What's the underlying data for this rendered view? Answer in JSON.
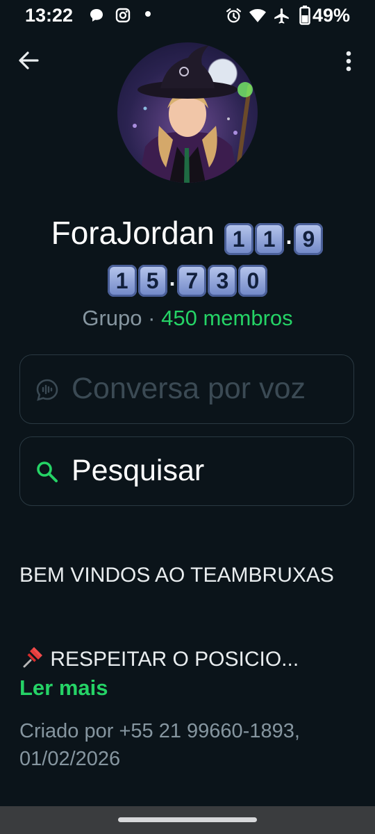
{
  "status_bar": {
    "time": "13:22",
    "battery": "49%",
    "icons": [
      "chat-bubble-icon",
      "instagram-icon",
      "dot-icon",
      "alarm-icon",
      "wifi-icon",
      "airplane-icon",
      "battery-icon"
    ]
  },
  "group": {
    "name_text": "ForaJordan",
    "name_keycaps_1": [
      "1",
      "1"
    ],
    "name_sep_1": ".",
    "name_keycaps_2": [
      "9"
    ],
    "line2_keycaps_1": [
      "1",
      "5"
    ],
    "line2_sep_1": ".",
    "line2_keycaps_2": [
      "7",
      "3",
      "0"
    ],
    "type": "Grupo",
    "separator": "·",
    "members": "450 membros"
  },
  "voice_chat": {
    "label": "Conversa por voz"
  },
  "search": {
    "label": "Pesquisar"
  },
  "description": {
    "line": "BEM VINDOS AO TEAMBRUXAS",
    "pin_text": "RESPEITAR O POSICIO...",
    "read_more": "Ler mais",
    "created": "Criado por +55 21 99660-1893, 01/02/2026"
  },
  "colors": {
    "background": "#0b141a",
    "accent": "#25d366",
    "muted": "#8696a0"
  }
}
